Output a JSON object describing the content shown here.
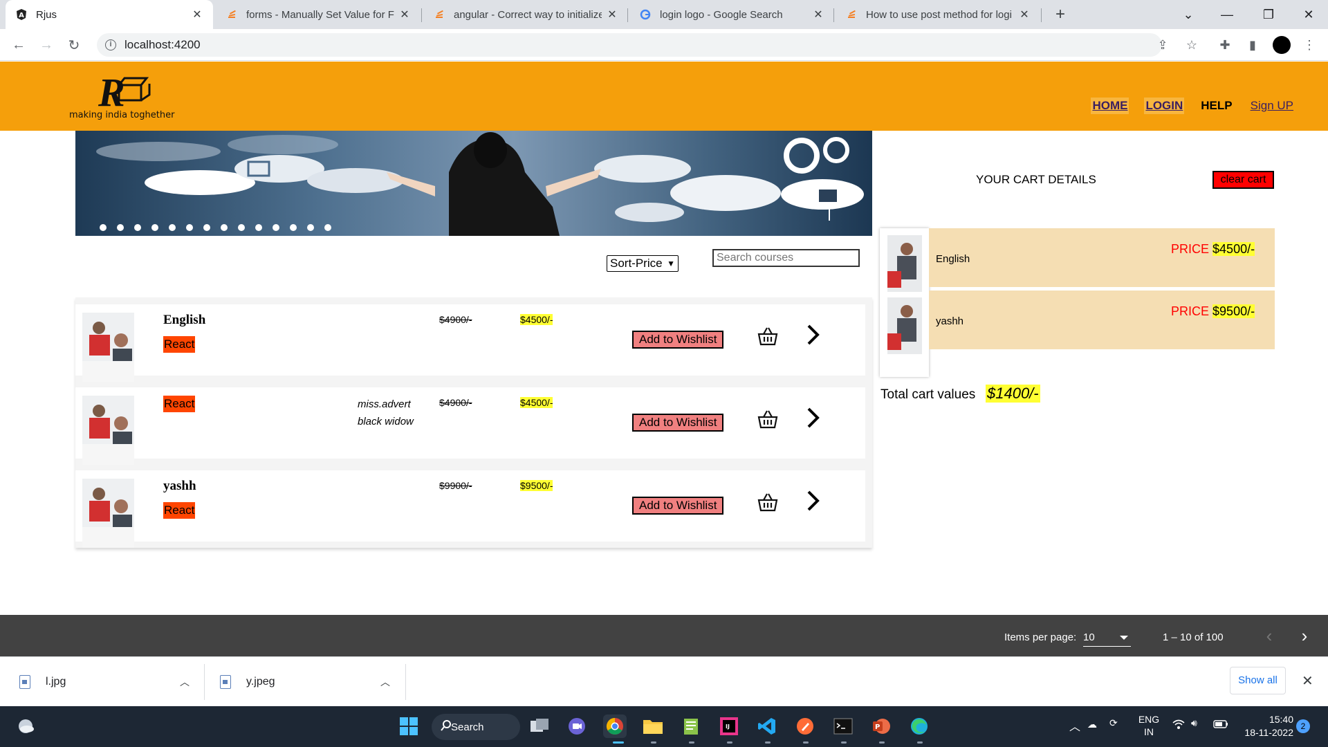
{
  "browser": {
    "tabs": [
      {
        "title": "Rjus",
        "active": true,
        "favicon": "angular-icon"
      },
      {
        "title": "forms - Manually Set Value for Fo",
        "active": false,
        "favicon": "stackoverflow-icon"
      },
      {
        "title": "angular - Correct way to initialize",
        "active": false,
        "favicon": "stackoverflow-icon"
      },
      {
        "title": "login logo - Google Search",
        "active": false,
        "favicon": "google-icon"
      },
      {
        "title": "How to use post method for logi",
        "active": false,
        "favicon": "stackoverflow-icon"
      }
    ],
    "url": "localhost:4200"
  },
  "header": {
    "logo_tagline": "making india toghether",
    "nav": {
      "home": "HOME",
      "login": "LOGIN",
      "help": "HELP",
      "signup": "Sign UP"
    },
    "brand_color": "#f59f0b"
  },
  "controls": {
    "sort_label": "Sort-Price",
    "search_placeholder": "Search courses"
  },
  "courses": [
    {
      "name": "English",
      "tag": "React",
      "description": [
        "",
        ""
      ],
      "old_price": "$4900/-",
      "new_price": "$4500/-",
      "wishlist_label": "Add to Wishlist"
    },
    {
      "name": "",
      "tag": "React",
      "description": [
        "miss.advert",
        "black widow"
      ],
      "old_price": "$4900/-",
      "new_price": "$4500/-",
      "wishlist_label": "Add to Wishlist"
    },
    {
      "name": "yashh",
      "tag": "React",
      "description": [
        "",
        ""
      ],
      "old_price": "$9900/-",
      "new_price": "$9500/-",
      "wishlist_label": "Add to Wishlist"
    }
  ],
  "cart": {
    "title": "YOUR CART DETAILS",
    "clear_label": "clear cart",
    "items": [
      {
        "name": "English",
        "price_label": "PRICE",
        "price": "$4500/-"
      },
      {
        "name": "yashh",
        "price_label": "PRICE",
        "price": "$9500/-"
      }
    ],
    "total_label": "Total cart values",
    "total_value": "$1400/-"
  },
  "paginator": {
    "items_per_page_label": "Items per page:",
    "items_per_page": "10",
    "range": "1 – 10 of 100"
  },
  "downloads": {
    "items": [
      "l.jpg",
      "y.jpeg"
    ],
    "show_all": "Show all"
  },
  "taskbar": {
    "search_label": "Search",
    "lang": "ENG",
    "region": "IN",
    "time": "15:40",
    "date": "18-11-2022",
    "notifications": "2"
  }
}
